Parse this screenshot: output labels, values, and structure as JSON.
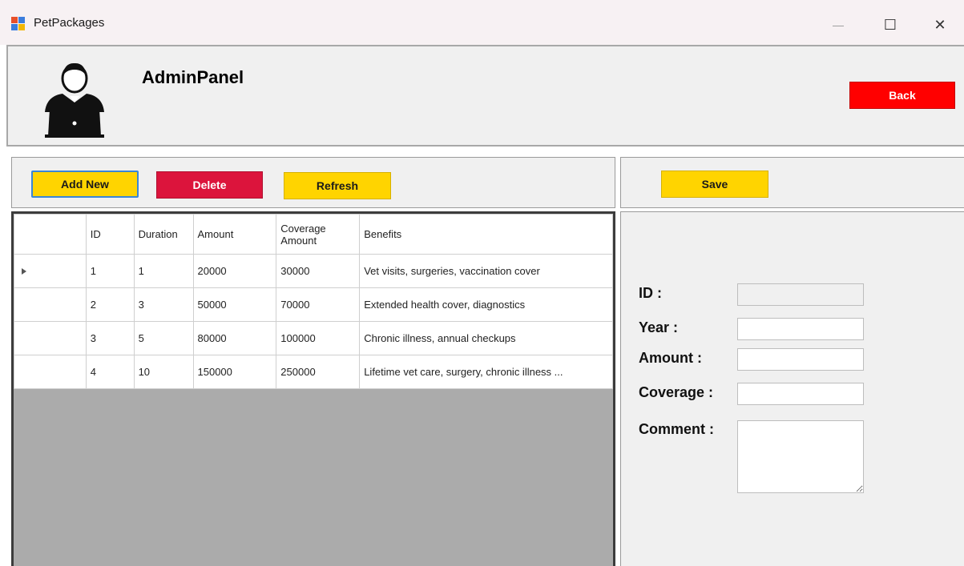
{
  "window": {
    "title": "PetPackages",
    "minimize_glyph": "—",
    "maximize_glyph": "☐",
    "close_glyph": "✕"
  },
  "header": {
    "icon": "admin-user-laptop-icon",
    "title": "AdminPanel",
    "back_label": "Back"
  },
  "toolbar": {
    "add_label": "Add New",
    "delete_label": "Delete",
    "refresh_label": "Refresh",
    "save_label": "Save"
  },
  "colors": {
    "yellow": "#ffd400",
    "red": "#ff0000",
    "crimson": "#dc143c",
    "grid_empty": "#ababab"
  },
  "grid": {
    "columns": [
      "ID",
      "Duration",
      "Amount",
      "Coverage Amount",
      "Benefits"
    ],
    "rows": [
      {
        "id": "1",
        "duration": "1",
        "amount": "20000",
        "coverage": "30000",
        "benefits": "Vet visits, surgeries, vaccination cover"
      },
      {
        "id": "2",
        "duration": "3",
        "amount": "50000",
        "coverage": "70000",
        "benefits": "Extended health cover, diagnostics"
      },
      {
        "id": "3",
        "duration": "5",
        "amount": "80000",
        "coverage": "100000",
        "benefits": "Chronic illness, annual checkups"
      },
      {
        "id": "4",
        "duration": "10",
        "amount": "150000",
        "coverage": "250000",
        "benefits": "Lifetime vet care, surgery, chronic illness ..."
      }
    ]
  },
  "form": {
    "id_label": "ID :",
    "year_label": "Year :",
    "amount_label": "Amount :",
    "coverage_label": "Coverage :",
    "comment_label": "Comment :",
    "id_value": "",
    "year_value": "",
    "amount_value": "",
    "coverage_value": "",
    "comment_value": ""
  }
}
